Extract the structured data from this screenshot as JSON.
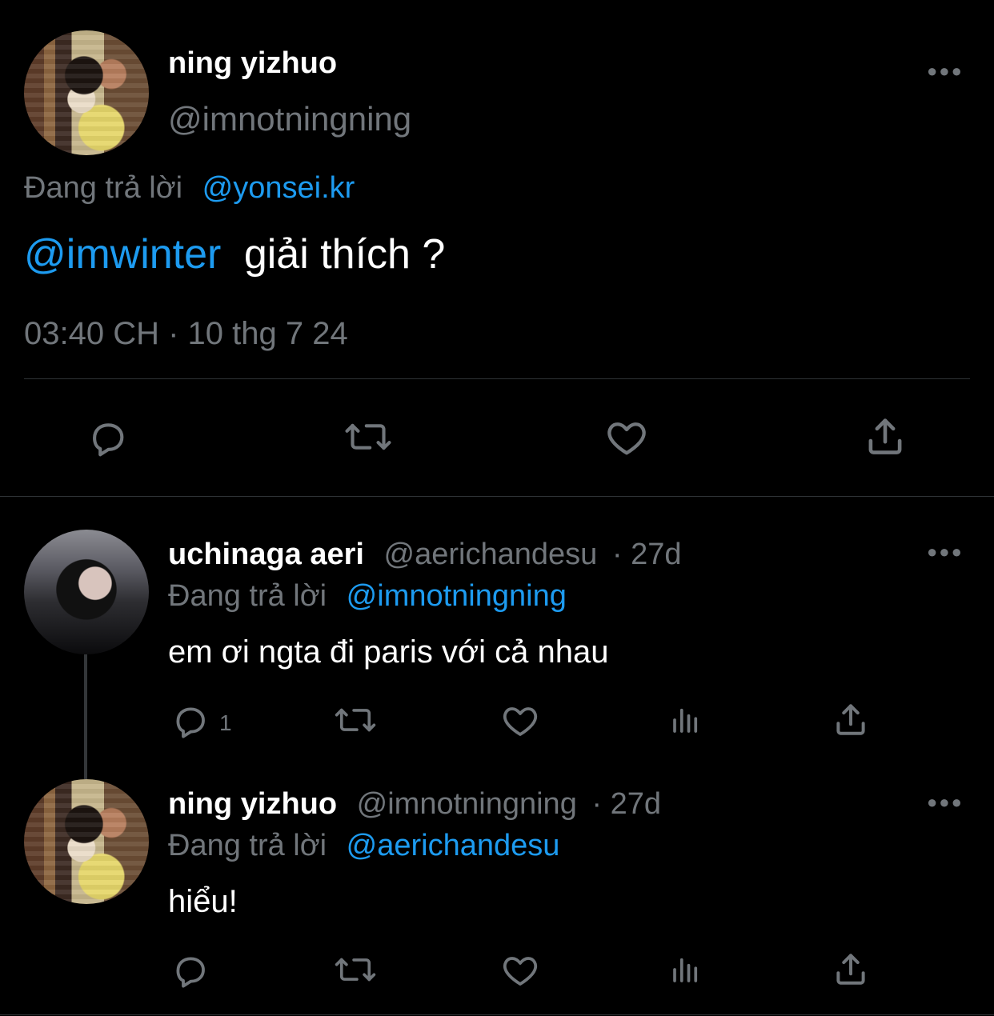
{
  "tweet": {
    "author_name": "ning yizhuo",
    "author_handle": "@imnotningning",
    "replying_label": "Đang trả lời",
    "replying_to": "@yonsei.kr",
    "mention": "@imwinter",
    "text": "giải thích ?",
    "timestamp": "03:40 CH · 10 thg 7 24"
  },
  "replies": [
    {
      "author_name": "uchinaga aeri",
      "author_handle": "@aerichandesu",
      "age": "· 27d",
      "replying_label": "Đang trả lời",
      "replying_to": "@imnotningning",
      "text": "em ơi ngta đi paris với cả nhau",
      "reply_count": "1"
    },
    {
      "author_name": "ning yizhuo",
      "author_handle": "@imnotningning",
      "age": "· 27d",
      "replying_label": "Đang trả lời",
      "replying_to": "@aerichandesu",
      "text": "hiểu!"
    }
  ],
  "colors": {
    "background": "#000000",
    "text": "#ffffff",
    "muted": "#71767b",
    "link": "#1d9bf0",
    "divider": "#2f3336"
  },
  "icons": {
    "reply": "reply-icon",
    "retweet": "retweet-icon",
    "like": "like-icon",
    "share": "share-icon",
    "views": "views-icon",
    "more": "more-icon"
  }
}
